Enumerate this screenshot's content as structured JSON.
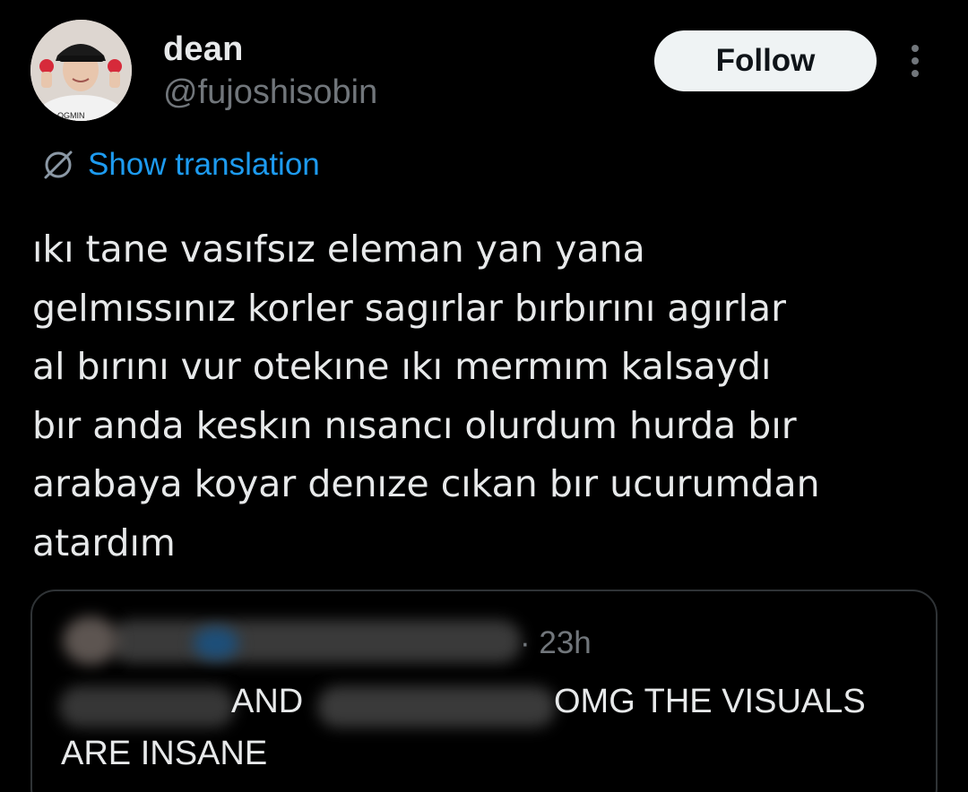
{
  "author": {
    "display_name": "dean",
    "handle": "@fujoshisobin",
    "avatar_icon": "user-avatar-photo",
    "avatar_shirt_text": "OGMIN"
  },
  "actions": {
    "follow_label": "Follow",
    "more_icon": "more-options-icon"
  },
  "translation": {
    "label": "Show translation",
    "icon": "globe-translate-icon",
    "color": "#1d9bf0"
  },
  "tweet": {
    "text": "ıkı tane vasıfsız eleman yan yana\ngelmıssınız korler sagırlar bırbırını agırlar\nal bırını vur otekıne ıkı mermım kalsaydı\nbır anda keskın nısancı olurdum hurda bır\narabaya koyar denıze cıkan bır ucurumdan\natardım"
  },
  "quote": {
    "time": "· 23h",
    "text_part_and": "AND",
    "text_part_omg": "OMG THE VISUALS",
    "text_line2": "ARE INSANE"
  },
  "colors": {
    "background": "#000000",
    "text_primary": "#e7e9ea",
    "text_secondary": "#71767b",
    "border": "#2f3336",
    "accent": "#1d9bf0"
  }
}
